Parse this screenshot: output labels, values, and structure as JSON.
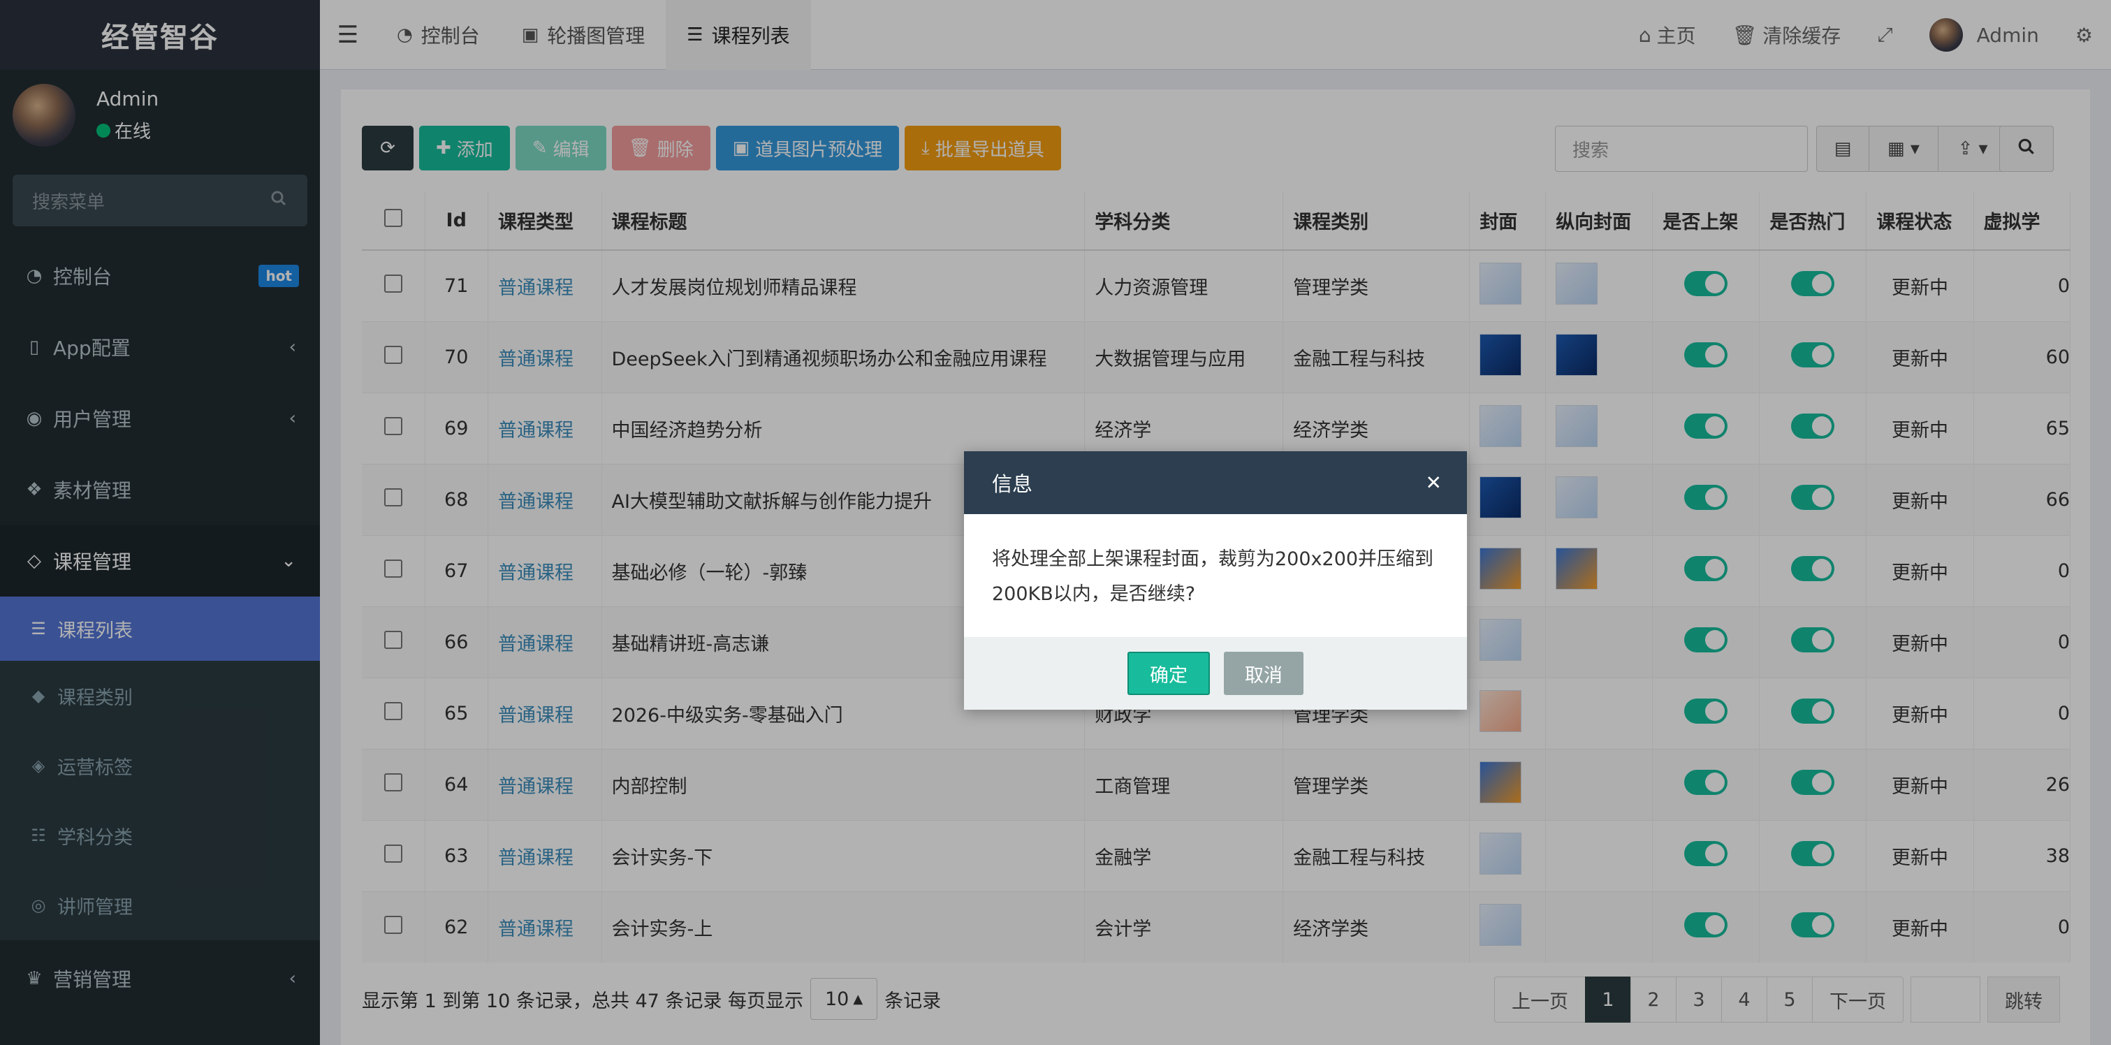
{
  "sidebar": {
    "brand": "经管智谷",
    "user_name": "Admin",
    "user_status": "在线",
    "search_placeholder": "搜索菜单",
    "hot_badge": "hot",
    "menu": [
      {
        "label": "控制台",
        "icon": "dashboard-icon"
      },
      {
        "label": "App配置",
        "icon": "mobile-icon"
      },
      {
        "label": "用户管理",
        "icon": "user-circle-icon"
      },
      {
        "label": "素材管理",
        "icon": "cubes-icon"
      },
      {
        "label": "课程管理",
        "icon": "gem-icon"
      },
      {
        "label": "营销管理",
        "icon": "trophy-icon"
      }
    ],
    "submenu": [
      {
        "label": "课程列表",
        "icon": "list-icon"
      },
      {
        "label": "课程类别",
        "icon": "tag-icon"
      },
      {
        "label": "运营标签",
        "icon": "tags-icon"
      },
      {
        "label": "学科分类",
        "icon": "list-ul-icon"
      },
      {
        "label": "讲师管理",
        "icon": "user-icon"
      }
    ]
  },
  "topbar": {
    "tabs": [
      {
        "label": "控制台",
        "icon": "dashboard-icon"
      },
      {
        "label": "轮播图管理",
        "icon": "image-icon"
      },
      {
        "label": "课程列表",
        "icon": "list-icon"
      }
    ],
    "home": "主页",
    "clear_cache": "清除缓存",
    "admin": "Admin"
  },
  "toolbar": {
    "add": "添加",
    "edit": "编辑",
    "delete": "删除",
    "preprocess": "道具图片预处理",
    "export": "批量导出道具",
    "search_placeholder": "搜索"
  },
  "table": {
    "columns": [
      "Id",
      "课程类型",
      "课程标题",
      "学科分类",
      "课程类别",
      "封面",
      "纵向封面",
      "是否上架",
      "是否热门",
      "课程状态",
      "虚拟学"
    ],
    "rows": [
      {
        "id": "71",
        "type": "普通课程",
        "title": "人才发展岗位规划师精品课程",
        "subject": "人力资源管理",
        "category": "管理学类",
        "status": "更新中",
        "virtual": "0"
      },
      {
        "id": "70",
        "type": "普通课程",
        "title": "DeepSeek入门到精通视频职场办公和金融应用课程",
        "subject": "大数据管理与应用",
        "category": "金融工程与科技",
        "status": "更新中",
        "virtual": "60"
      },
      {
        "id": "69",
        "type": "普通课程",
        "title": "中国经济趋势分析",
        "subject": "经济学",
        "category": "经济学类",
        "status": "更新中",
        "virtual": "65"
      },
      {
        "id": "68",
        "type": "普通课程",
        "title": "AI大模型辅助文献拆解与创作能力提升",
        "subject": "",
        "category": "",
        "status": "更新中",
        "virtual": "66"
      },
      {
        "id": "67",
        "type": "普通课程",
        "title": "基础必修（一轮）-郭臻",
        "subject": "",
        "category": "",
        "status": "更新中",
        "virtual": "0"
      },
      {
        "id": "66",
        "type": "普通课程",
        "title": "基础精讲班-高志谦",
        "subject": "",
        "category": "",
        "status": "更新中",
        "virtual": "0"
      },
      {
        "id": "65",
        "type": "普通课程",
        "title": "2026-中级实务-零基础入门",
        "subject": "财政学",
        "category": "管理学类",
        "status": "更新中",
        "virtual": "0"
      },
      {
        "id": "64",
        "type": "普通课程",
        "title": "内部控制",
        "subject": "工商管理",
        "category": "管理学类",
        "status": "更新中",
        "virtual": "26"
      },
      {
        "id": "63",
        "type": "普通课程",
        "title": "会计实务-下",
        "subject": "金融学",
        "category": "金融工程与科技",
        "status": "更新中",
        "virtual": "38"
      },
      {
        "id": "62",
        "type": "普通课程",
        "title": "会计实务-上",
        "subject": "会计学",
        "category": "经济学类",
        "status": "更新中",
        "virtual": "0"
      }
    ]
  },
  "footer": {
    "info_prefix": "显示第 1 到第 10 条记录，总共 47 条记录 每页显示",
    "page_size": "10",
    "info_suffix": "条记录",
    "prev": "上一页",
    "pages": [
      "1",
      "2",
      "3",
      "4",
      "5"
    ],
    "next": "下一页",
    "jump": "跳转"
  },
  "dialog": {
    "title": "信息",
    "message": "将处理全部上架课程封面，裁剪为200x200并压缩到200KB以内，是否继续?",
    "ok": "确定",
    "cancel": "取消"
  }
}
